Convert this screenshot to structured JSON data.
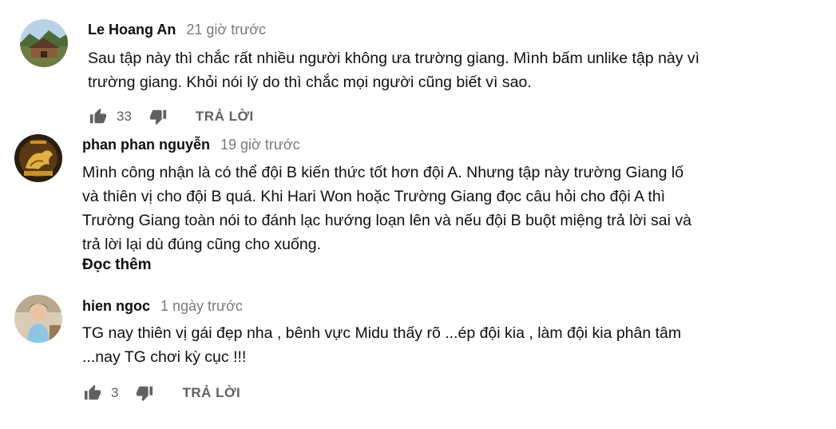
{
  "comments": [
    {
      "author": "Le Hoang An",
      "time": "21 giờ trước",
      "text_lines": [
        "Sau tập này thì chắc rất nhiều người không ưa trường giang. Mình bấm unlike tập này vì",
        "trường giang. Khỏi nói lý do thì chắc  mọi người cũng biết vì sao."
      ],
      "likes": "33",
      "reply_label": "TRẢ LỜI"
    },
    {
      "author": "phan phan nguyễn",
      "time": "19 giờ trước",
      "text_lines": [
        "Mình công nhận là có thể đội B kiến thức tốt hơn đội A. Nhưng tập này trường Giang lố",
        "và thiên vị cho đội B quá. Khi Hari Won hoặc Trường Giang đọc câu hỏi cho đội A thì",
        "Trường Giang toàn nói to đánh lạc hướng loạn lên và nếu đội B buột miệng trả lời sai và",
        "trả lời lại dù đúng cũng cho xuống."
      ],
      "read_more": "Đọc thêm"
    },
    {
      "author": "hien ngoc",
      "time": "1 ngày trước",
      "text_lines": [
        "TG nay thiên vị gái đẹp nha , bênh vực Midu thấy rõ ...ép đội kia , làm đội kia phân tâm",
        "...nay TG chơi kỳ cục !!!"
      ],
      "likes": "3",
      "reply_label": "TRẢ LỜI"
    }
  ],
  "icons": {
    "like": "thumb-up-icon",
    "dislike": "thumb-down-icon"
  },
  "colors": {
    "author": "#0f0f0f",
    "timestamp": "#7a7a7a",
    "action": "#606060"
  }
}
